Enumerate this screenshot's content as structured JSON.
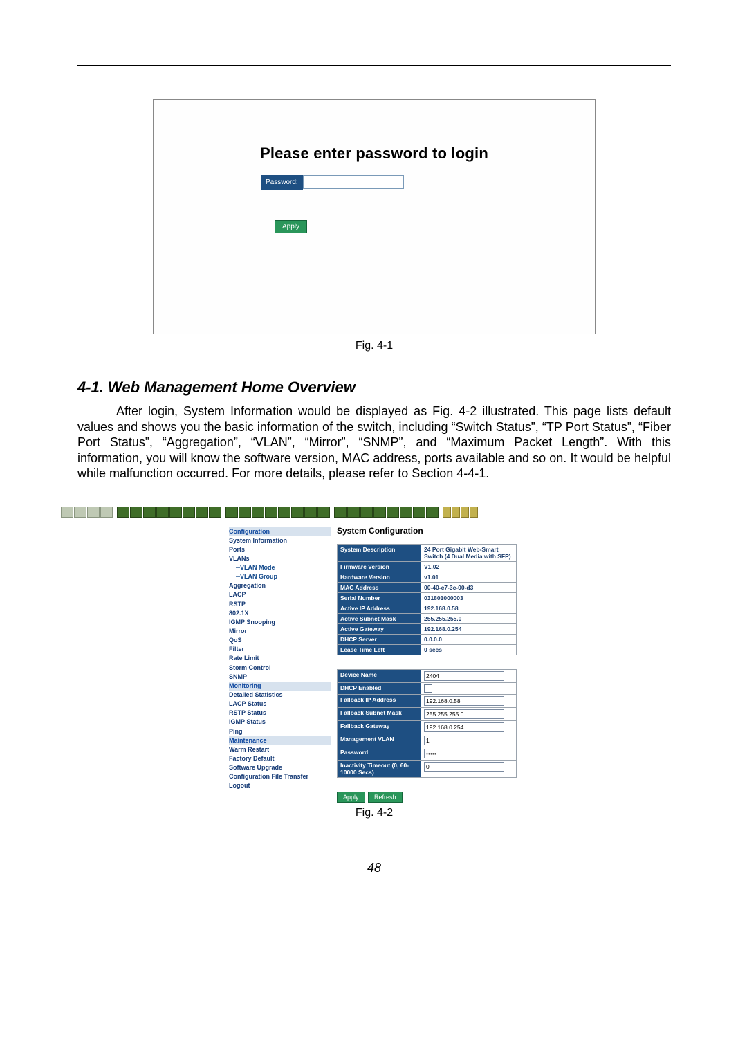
{
  "fig1": {
    "title": "Please enter password to login",
    "password_label": "Password:",
    "password_value": "",
    "apply_label": "Apply",
    "caption": "Fig. 4-1"
  },
  "section_heading": "4-1. Web Management Home Overview",
  "paragraph": "After login, System Information would be displayed as Fig. 4-2 illustrated. This page lists default values and shows you the basic information of the switch, including “Switch Status”, “TP Port Status”, “Fiber Port Status”, “Aggregation”, “VLAN”, “Mirror”, “SNMP”, and “Maximum Packet Length”. With this information, you will know the software version, MAC address, ports available and so on. It would be helpful while malfunction occurred. For more details, please refer to Section 4-4-1.",
  "sidebar": {
    "items": [
      {
        "label": "Configuration",
        "cls": "section"
      },
      {
        "label": "System Information"
      },
      {
        "label": "Ports"
      },
      {
        "label": "VLANs"
      },
      {
        "label": "--VLAN Mode",
        "cls": "indent"
      },
      {
        "label": "--VLAN Group",
        "cls": "indent"
      },
      {
        "label": "Aggregation"
      },
      {
        "label": "LACP"
      },
      {
        "label": "RSTP"
      },
      {
        "label": "802.1X"
      },
      {
        "label": "IGMP Snooping"
      },
      {
        "label": "Mirror"
      },
      {
        "label": "QoS"
      },
      {
        "label": "Filter"
      },
      {
        "label": "Rate Limit"
      },
      {
        "label": "Storm Control"
      },
      {
        "label": "SNMP"
      },
      {
        "label": "Monitoring",
        "cls": "section"
      },
      {
        "label": "Detailed Statistics"
      },
      {
        "label": "LACP Status"
      },
      {
        "label": "RSTP Status"
      },
      {
        "label": "IGMP Status"
      },
      {
        "label": "Ping"
      },
      {
        "label": "Maintenance",
        "cls": "section"
      },
      {
        "label": "Warm Restart"
      },
      {
        "label": "Factory Default"
      },
      {
        "label": "Software Upgrade"
      },
      {
        "label": "Configuration File Transfer"
      },
      {
        "label": "Logout"
      }
    ]
  },
  "main_title": "System Configuration",
  "info_rows": [
    {
      "label": "System Description",
      "value": "24 Port Gigabit Web-Smart Switch (4 Dual Media with SFP)"
    },
    {
      "label": "Firmware Version",
      "value": "V1.02"
    },
    {
      "label": "Hardware Version",
      "value": "v1.01"
    },
    {
      "label": "MAC Address",
      "value": "00-40-c7-3c-00-d3"
    },
    {
      "label": "Serial Number",
      "value": "031801000003"
    },
    {
      "label": "Active IP Address",
      "value": "192.168.0.58"
    },
    {
      "label": "Active Subnet Mask",
      "value": "255.255.255.0"
    },
    {
      "label": "Active Gateway",
      "value": "192.168.0.254"
    },
    {
      "label": "DHCP Server",
      "value": "0.0.0.0"
    },
    {
      "label": "Lease Time Left",
      "value": "0 secs"
    }
  ],
  "cfg_rows": [
    {
      "label": "Device Name",
      "type": "text",
      "value": "2404"
    },
    {
      "label": "DHCP Enabled",
      "type": "check",
      "value": false
    },
    {
      "label": "Fallback IP Address",
      "type": "text",
      "value": "192.168.0.58"
    },
    {
      "label": "Fallback Subnet Mask",
      "type": "text",
      "value": "255.255.255.0"
    },
    {
      "label": "Fallback Gateway",
      "type": "text",
      "value": "192.168.0.254"
    },
    {
      "label": "Management VLAN",
      "type": "text",
      "value": "1"
    },
    {
      "label": "Password",
      "type": "password",
      "value": "*****"
    },
    {
      "label": "Inactivity Timeout (0, 60-10000 Secs)",
      "type": "text",
      "value": "0"
    }
  ],
  "buttons": {
    "apply": "Apply",
    "refresh": "Refresh"
  },
  "fig2_caption": "Fig. 4-2",
  "page_number": "48"
}
